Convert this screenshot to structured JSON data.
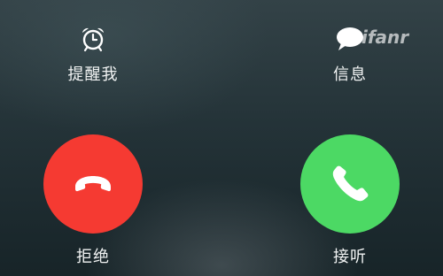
{
  "call_actions": {
    "remind": {
      "label": "提醒我",
      "icon": "alarm-clock-icon"
    },
    "message": {
      "label": "信息",
      "icon": "message-bubble-icon"
    },
    "decline": {
      "label": "拒绝",
      "icon": "phone-hangup-icon",
      "color": "#f53a32"
    },
    "accept": {
      "label": "接听",
      "icon": "phone-icon",
      "color": "#4cd964"
    }
  },
  "watermark": {
    "text": "ifanr"
  }
}
